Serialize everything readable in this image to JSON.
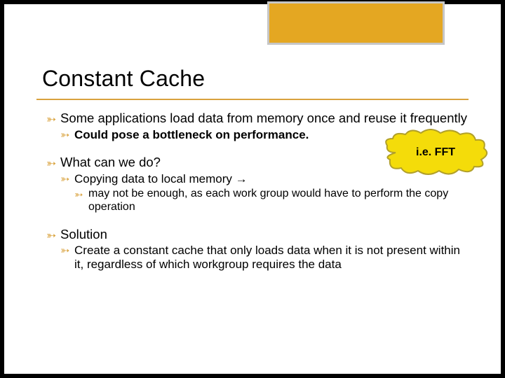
{
  "title": "Constant Cache",
  "lines": {
    "some_apps": "Some applications load data from memory once and reuse it frequently",
    "could_pose": "Could pose a bottleneck on performance.",
    "what_can": "What can we do?",
    "copying": "Copying data to local memory →",
    "may_not": "may not be enough, as each work group would have to perform the copy operation",
    "solution": "Solution",
    "create": "Create a constant cache that only loads data when it is not present within it, regardless of which workgroup requires the data"
  },
  "bubble_label": "i.e. FFT",
  "colors": {
    "accent_box": "#e4a722",
    "rule": "#d9a23d",
    "bubble_fill": "#f4dc0a",
    "bubble_stroke": "#b1a02a"
  }
}
